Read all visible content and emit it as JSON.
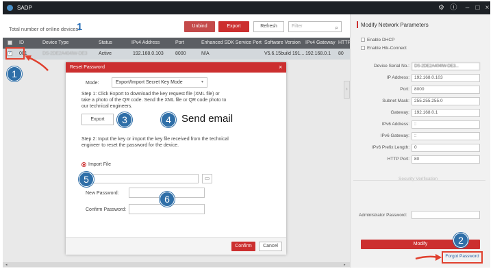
{
  "window": {
    "title": "SADP",
    "icons": [
      "gear-icon",
      "info-icon",
      "minimize-icon",
      "maximize-icon",
      "close-icon"
    ]
  },
  "toolbar": {
    "count_label": "Total number of online devices:",
    "count": "1",
    "unbind_label": "Unbind",
    "export_label": "Export",
    "refresh_label": "Refresh",
    "filter_placeholder": "Filter"
  },
  "table": {
    "headers": [
      "ID",
      "Device Type",
      "Status",
      "IPv4 Address",
      "Port",
      "Enhanced SDK Service Port",
      "Software Version",
      "IPv4 Gateway",
      "HTTP"
    ],
    "row": {
      "id": "001",
      "device_type": "DS-2DE2A404IW-DE3",
      "status": "Active",
      "ipv4": "192.168.0.103",
      "port": "8000",
      "sdk_port": "N/A",
      "software": "V5.6.15build 191...",
      "gateway": "192.168.0.1",
      "http": "80"
    }
  },
  "right_panel": {
    "title": "Modify Network Parameters",
    "enable_dhcp": "Enable DHCP",
    "enable_hik": "Enable Hik-Connect",
    "fields": [
      {
        "label": "Device Serial No.:",
        "value": "DS-2DE2A404IW-DE3..."
      },
      {
        "label": "IP Address:",
        "value": "192.168.0.103"
      },
      {
        "label": "Port:",
        "value": "8000"
      },
      {
        "label": "Subnet Mask:",
        "value": "255.255.255.0"
      },
      {
        "label": "Gateway:",
        "value": "192.168.0.1"
      },
      {
        "label": "IPv6 Address:",
        "value": "::"
      },
      {
        "label": "IPv6 Gateway:",
        "value": "::"
      },
      {
        "label": "IPv6 Prefix Length:",
        "value": "0"
      },
      {
        "label": "HTTP Port:",
        "value": "80"
      }
    ],
    "security_verification": "Security Verification",
    "admin_password_label": "Administrator Password:",
    "modify_label": "Modify",
    "forgot_label": "Forgot Password"
  },
  "dialog": {
    "title": "Reset Password",
    "mode_label": "Mode:",
    "mode_value": "Export/Import Secret Key Mode",
    "step1": "Step 1: Click Export to download the key request file (XML file) or take a photo of the QR code. Send the XML file or QR code photo to our technical engineers.",
    "export_label": "Export",
    "step2": "Step 2: Input the key or import the key file received from the technical engineer to reset the password for the device.",
    "import_label": "Import File",
    "new_password_label": "New Password:",
    "confirm_password_label": "Confirm Password:",
    "confirm_label": "Confirm",
    "cancel_label": "Cancel"
  },
  "annotations": {
    "n1": "1",
    "n2": "2",
    "n3": "3",
    "n4": "4",
    "n5": "5",
    "n6": "6",
    "send_email": "Send email"
  },
  "colors": {
    "accent_red": "#cc2f2f",
    "badge_blue": "#2f6fa8",
    "titlebar": "#1d2126"
  }
}
